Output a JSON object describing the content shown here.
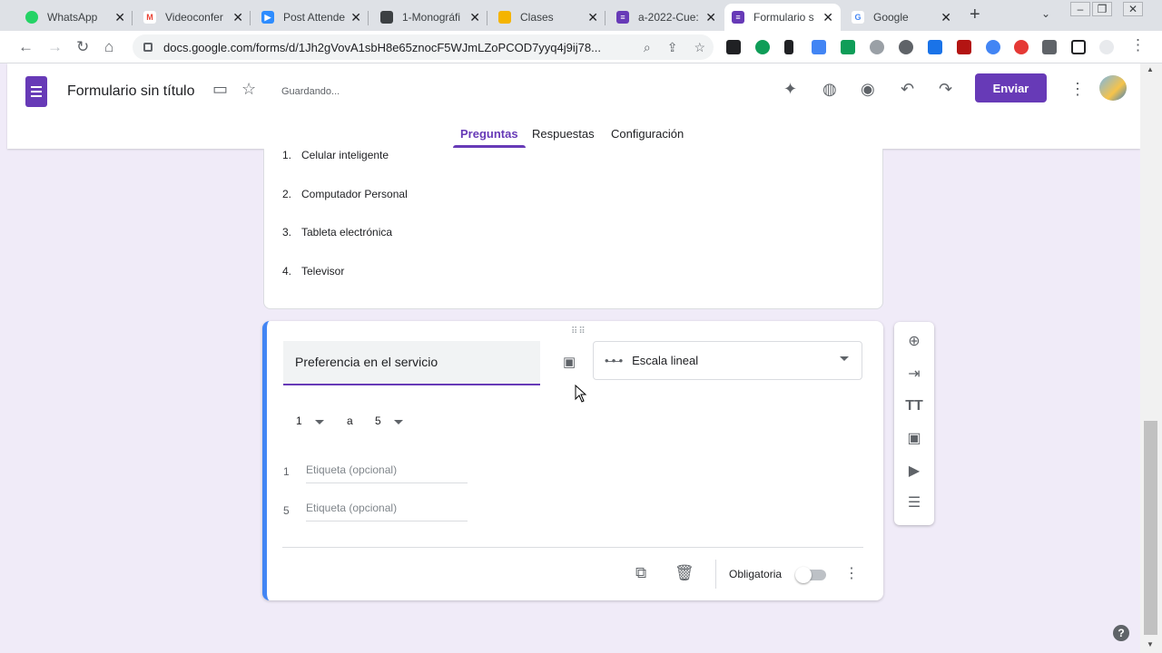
{
  "browser": {
    "tabs": [
      {
        "title": "WhatsApp",
        "color": "#25d366",
        "glyph": "✆"
      },
      {
        "title": "Videoconfer",
        "color": "#ea4335",
        "glyph": "M"
      },
      {
        "title": "Post Attende",
        "color": "#2d8cff",
        "glyph": "▶"
      },
      {
        "title": "1-Monográfi",
        "color": "#3c4043",
        "glyph": "▣"
      },
      {
        "title": "Clases",
        "color": "#f4b400",
        "glyph": "▤"
      },
      {
        "title": "a-2022-Cue:",
        "color": "#673ab7",
        "glyph": "≡"
      },
      {
        "title": "Formulario s",
        "color": "#673ab7",
        "glyph": "≡"
      },
      {
        "title": "Google",
        "color": "#4285f4",
        "glyph": "G"
      }
    ],
    "url": "docs.google.com/forms/d/1Jh2gVovA1sbH8e65znocF5WJmLZoPCOD7yyq4j9ij78..."
  },
  "header": {
    "title": "Formulario sin título",
    "status": "Guardando...",
    "send_label": "Enviar",
    "tabs": [
      "Preguntas",
      "Respuestas",
      "Configuración"
    ]
  },
  "prev_question": {
    "options": [
      {
        "n": "1.",
        "text": "Celular inteligente"
      },
      {
        "n": "2.",
        "text": "Computador Personal"
      },
      {
        "n": "3.",
        "text": "Tableta electrónica"
      },
      {
        "n": "4.",
        "text": "Televisor"
      }
    ]
  },
  "question": {
    "title": "Preferencia en el servicio",
    "type": "Escala lineal",
    "scale_min": "1",
    "scale_sep": "a",
    "scale_max": "5",
    "label_min_num": "1",
    "label_max_num": "5",
    "label_placeholder": "Etiqueta (opcional)",
    "required_label": "Obligatoria"
  },
  "colors": {
    "accent": "#673ab7",
    "focus_bar": "#4285f4",
    "background": "#f0ebf8"
  }
}
